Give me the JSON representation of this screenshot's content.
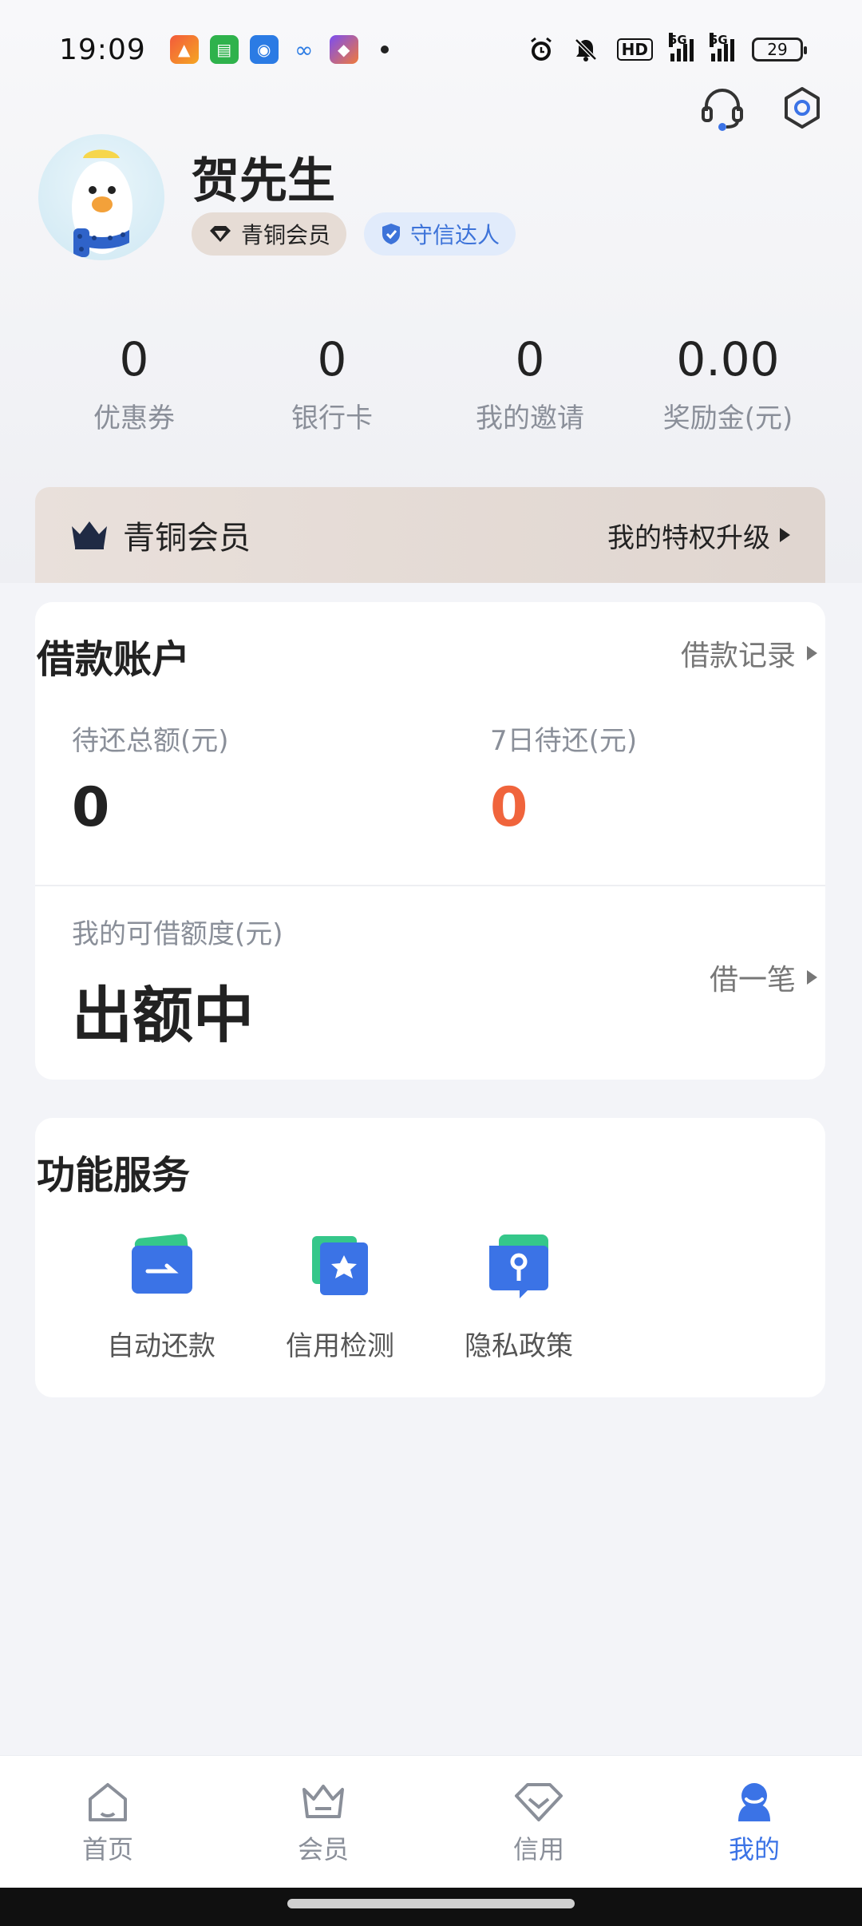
{
  "status_bar": {
    "time": "19:09",
    "signal_1": "5G",
    "signal_2": "5G",
    "hd_label": "HD",
    "battery": "29"
  },
  "header": {
    "icons": [
      "headset-icon",
      "gear-icon"
    ]
  },
  "profile": {
    "name": "贺先生",
    "member_badge": "青铜会员",
    "trust_badge": "守信达人"
  },
  "stats": [
    {
      "value": "0",
      "label": "优惠券"
    },
    {
      "value": "0",
      "label": "银行卡"
    },
    {
      "value": "0",
      "label": "我的邀请"
    },
    {
      "value": "0.00",
      "label": "奖励金(元)"
    }
  ],
  "member_bar": {
    "title": "青铜会员",
    "link": "我的特权升级"
  },
  "loan_account": {
    "title": "借款账户",
    "records_link": "借款记录",
    "total_due_label": "待还总额(元)",
    "total_due_value": "0",
    "seven_day_label": "7日待还(元)",
    "seven_day_value": "0",
    "credit_label": "我的可借额度(元)",
    "credit_value": "出额中",
    "borrow_link": "借一笔"
  },
  "services": {
    "title": "功能服务",
    "items": [
      {
        "label": "自动还款",
        "icon": "auto-repay-icon"
      },
      {
        "label": "信用检测",
        "icon": "credit-check-icon"
      },
      {
        "label": "隐私政策",
        "icon": "privacy-policy-icon"
      }
    ]
  },
  "tab_bar": {
    "tabs": [
      {
        "label": "首页",
        "icon": "home-icon"
      },
      {
        "label": "会员",
        "icon": "crown-icon"
      },
      {
        "label": "信用",
        "icon": "diamond-icon"
      },
      {
        "label": "我的",
        "icon": "profile-icon",
        "active": true
      }
    ]
  },
  "colors": {
    "accent_blue": "#3b73e6",
    "warning_orange": "#f0643c",
    "bronze_bg": "#e6dcd5"
  }
}
